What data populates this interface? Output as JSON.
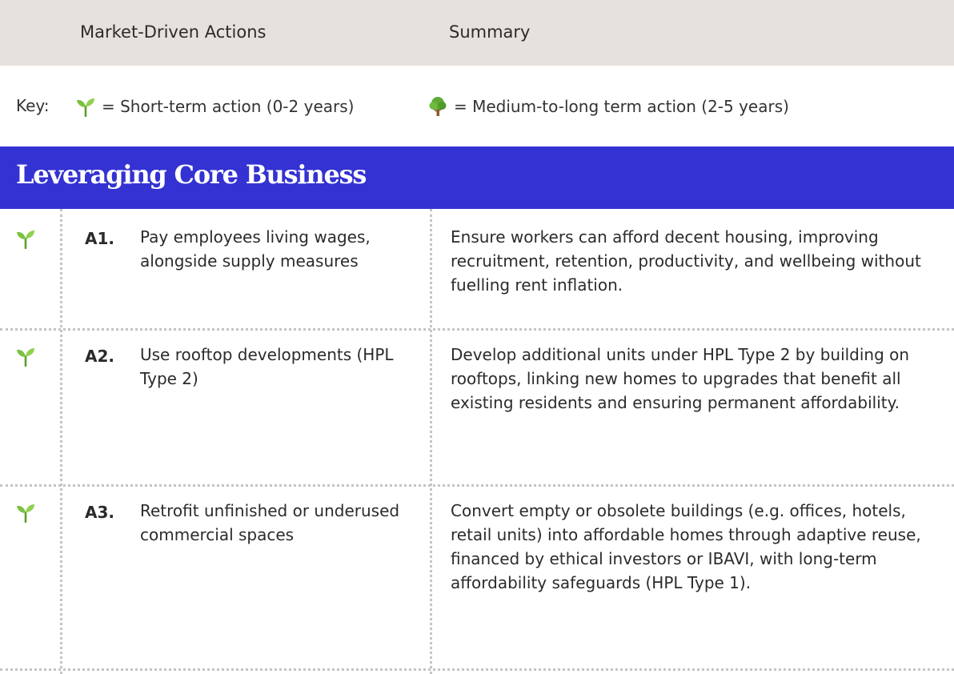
{
  "header": {
    "actions_label": "Market-Driven Actions",
    "summary_label": "Summary"
  },
  "key": {
    "label": "Key:",
    "short_term": "= Short-term action (0-2 years)",
    "medium_term": "= Medium-to-long term action (2-5 years)",
    "short_icon": "seedling-icon",
    "medium_icon": "tree-icon"
  },
  "section": {
    "title": "Leveraging Core Business",
    "color": "#3432d2"
  },
  "rows": [
    {
      "icon": "seedling-icon",
      "code": "A1.",
      "title": "Pay employees living wages, alongside supply measures",
      "summary": "Ensure workers can afford decent housing, improving recruitment, retention, productivity, and wellbeing without fuelling rent inflation."
    },
    {
      "icon": "seedling-icon",
      "code": "A2.",
      "title": "Use rooftop developments (HPL Type 2)",
      "summary": "Develop additional units under HPL Type 2 by building on rooftops, linking new homes to upgrades that benefit all existing residents and ensuring permanent affordability."
    },
    {
      "icon": "seedling-icon",
      "code": "A3.",
      "title": "Retrofit unfinished or underused commercial spaces",
      "summary": "Convert empty or obsolete buildings (e.g. offices, hotels, retail units) into affordable homes through adaptive reuse, financed by ethical investors or IBAVI, with long-term affordability safeguards (HPL Type 1)."
    }
  ]
}
